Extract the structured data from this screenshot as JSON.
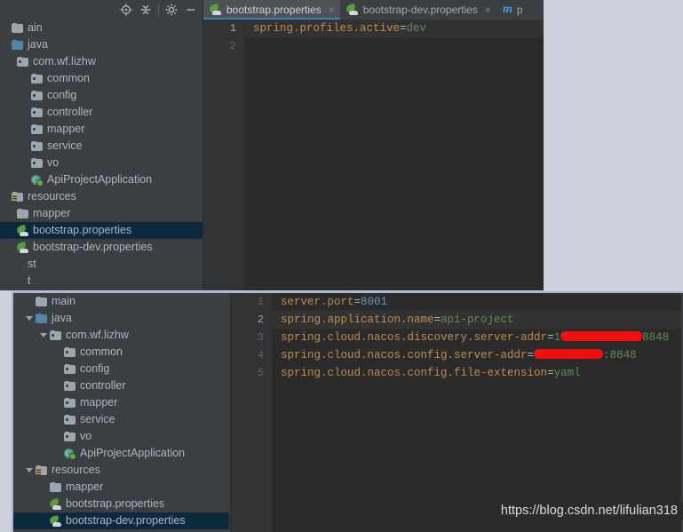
{
  "desktop": {
    "background": "#ccd1dc"
  },
  "top_window": {
    "toolbar": {
      "icons": [
        {
          "name": "locate-icon",
          "title": "Select Opened File"
        },
        {
          "name": "collapse-all-icon",
          "title": "Collapse All"
        },
        {
          "name": "gear-icon",
          "title": "Settings"
        },
        {
          "name": "minimize-icon",
          "title": "Hide"
        }
      ]
    },
    "tree": {
      "items": [
        {
          "label": "ain",
          "icon": "folder",
          "depth": 0,
          "arrow": false,
          "selected": false,
          "clipped": true
        },
        {
          "label": "java",
          "icon": "source-folder",
          "depth": 0,
          "arrow": false,
          "selected": false
        },
        {
          "label": "com.wf.lizhw",
          "icon": "package-folder",
          "depth": 1,
          "arrow": false,
          "selected": false
        },
        {
          "label": "common",
          "icon": "package-folder",
          "depth": 2,
          "arrow": false,
          "selected": false
        },
        {
          "label": "config",
          "icon": "package-folder",
          "depth": 2,
          "arrow": false,
          "selected": false
        },
        {
          "label": "controller",
          "icon": "package-folder",
          "depth": 2,
          "arrow": false,
          "selected": false
        },
        {
          "label": "mapper",
          "icon": "package-folder",
          "depth": 2,
          "arrow": false,
          "selected": false
        },
        {
          "label": "service",
          "icon": "package-folder",
          "depth": 2,
          "arrow": false,
          "selected": false
        },
        {
          "label": "vo",
          "icon": "package-folder",
          "depth": 2,
          "arrow": false,
          "selected": false
        },
        {
          "label": "ApiProjectApplication",
          "icon": "java-class",
          "depth": 2,
          "arrow": false,
          "selected": false
        },
        {
          "label": "resources",
          "icon": "resources-folder",
          "depth": 0,
          "arrow": false,
          "selected": false
        },
        {
          "label": "mapper",
          "icon": "folder",
          "depth": 1,
          "arrow": false,
          "selected": false
        },
        {
          "label": "bootstrap.properties",
          "icon": "properties-file",
          "depth": 1,
          "arrow": false,
          "selected": true
        },
        {
          "label": "bootstrap-dev.properties",
          "icon": "properties-file",
          "depth": 1,
          "arrow": false,
          "selected": false
        },
        {
          "label": "st",
          "icon": "none",
          "depth": 0,
          "arrow": false,
          "selected": false,
          "clipped": true
        },
        {
          "label": "t",
          "icon": "none",
          "depth": 0,
          "arrow": false,
          "selected": false,
          "clipped": true
        }
      ]
    },
    "tabs": [
      {
        "label": "bootstrap.properties",
        "icon": "properties-file-icon",
        "active": true,
        "close": "×"
      },
      {
        "label": "bootstrap-dev.properties",
        "icon": "properties-file-icon",
        "active": false,
        "close": "×"
      },
      {
        "label": "p",
        "icon": "maven-icon",
        "active": false,
        "close": ""
      }
    ],
    "editor": {
      "line_numbers": [
        "1",
        "2"
      ],
      "current_line": 1,
      "lines": [
        {
          "key": "spring.profiles.active",
          "eq": "=",
          "value": "dev",
          "value_type": "string"
        },
        {
          "key": "",
          "eq": "",
          "value": "",
          "value_type": "empty"
        }
      ]
    }
  },
  "bottom_window": {
    "tree": {
      "items": [
        {
          "label": "main",
          "icon": "folder",
          "depth": 0,
          "arrow": false,
          "selected": false
        },
        {
          "label": "java",
          "icon": "source-folder",
          "depth": 0,
          "arrow": true,
          "selected": false
        },
        {
          "label": "com.wf.lizhw",
          "icon": "package-folder",
          "depth": 1,
          "arrow": true,
          "selected": false
        },
        {
          "label": "common",
          "icon": "package-folder",
          "depth": 2,
          "arrow": false,
          "selected": false
        },
        {
          "label": "config",
          "icon": "package-folder",
          "depth": 2,
          "arrow": false,
          "selected": false
        },
        {
          "label": "controller",
          "icon": "package-folder",
          "depth": 2,
          "arrow": false,
          "selected": false
        },
        {
          "label": "mapper",
          "icon": "package-folder",
          "depth": 2,
          "arrow": false,
          "selected": false
        },
        {
          "label": "service",
          "icon": "package-folder",
          "depth": 2,
          "arrow": false,
          "selected": false
        },
        {
          "label": "vo",
          "icon": "package-folder",
          "depth": 2,
          "arrow": false,
          "selected": false
        },
        {
          "label": "ApiProjectApplication",
          "icon": "java-class",
          "depth": 2,
          "arrow": false,
          "selected": false
        },
        {
          "label": "resources",
          "icon": "resources-folder",
          "depth": 0,
          "arrow": true,
          "selected": false
        },
        {
          "label": "mapper",
          "icon": "folder",
          "depth": 1,
          "arrow": false,
          "selected": false
        },
        {
          "label": "bootstrap.properties",
          "icon": "properties-file",
          "depth": 1,
          "arrow": false,
          "selected": false
        },
        {
          "label": "bootstrap-dev.properties",
          "icon": "properties-file",
          "depth": 1,
          "arrow": false,
          "selected": true,
          "clipped": true
        }
      ]
    },
    "editor": {
      "line_numbers": [
        "1",
        "2",
        "3",
        "4",
        "5"
      ],
      "current_line": 2,
      "lines": [
        {
          "key": "server.port",
          "eq": "=",
          "value": "8001",
          "value_type": "number"
        },
        {
          "key": "spring.application.name",
          "eq": "=",
          "value": "api-project",
          "value_type": "string"
        },
        {
          "key": "spring.cloud.nacos.discovery.server-addr",
          "eq": "=",
          "value_prefix": "1",
          "redacted": true,
          "redaction_width": 92,
          "value_suffix": "8848",
          "value_type": "redacted"
        },
        {
          "key": "spring.cloud.nacos.config.server-addr",
          "eq": "=",
          "value_prefix": "",
          "redacted": true,
          "redaction_width": 78,
          "value_suffix": ":8848",
          "value_type": "redacted"
        },
        {
          "key": "spring.cloud.nacos.config.file-extension",
          "eq": "=",
          "value": "yaml",
          "value_type": "string"
        }
      ]
    }
  },
  "watermark": {
    "text": "https://blog.csdn.net/lifulian318"
  },
  "colors": {
    "editor_background": "#2b2b2b",
    "panel_background": "#3c3f41",
    "gutter_background": "#313335",
    "key": "#cc7832",
    "value_string": "#6a8759",
    "value_number": "#6897bb",
    "selection": "#0d293e",
    "tab_active_underline": "#3d7cc9",
    "redaction": "#f40f0f",
    "window_border": "#a8b4d4"
  }
}
